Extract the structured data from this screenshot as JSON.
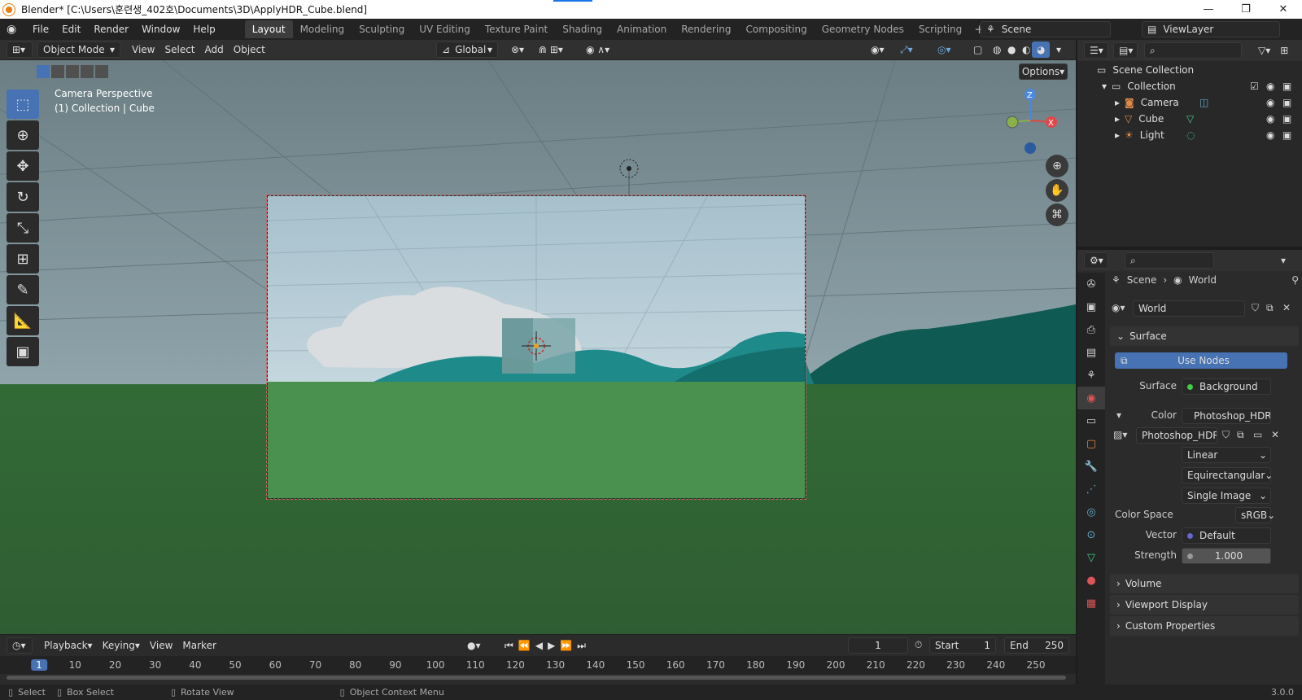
{
  "titlebar": {
    "title": "Blender* [C:\\Users\\훈련생_402호\\Documents\\3D\\ApplyHDR_Cube.blend]",
    "min": "—",
    "max": "❐",
    "close": "✕"
  },
  "menu": [
    "File",
    "Edit",
    "Render",
    "Window",
    "Help"
  ],
  "workspaces": [
    "Layout",
    "Modeling",
    "Sculpting",
    "UV Editing",
    "Texture Paint",
    "Shading",
    "Animation",
    "Rendering",
    "Compositing",
    "Geometry Nodes",
    "Scripting"
  ],
  "scene": "Scene",
  "viewlayer": "ViewLayer",
  "viewport_header": {
    "mode": "Object Mode",
    "menus": [
      "View",
      "Select",
      "Add",
      "Object"
    ],
    "orientation": "Global"
  },
  "viewport": {
    "line1": "Camera Perspective",
    "line2": "(1) Collection | Cube",
    "options": "Options"
  },
  "gizmo": {
    "z": "Z",
    "x": "X"
  },
  "timeline": {
    "menus": [
      "Playback",
      "Keying",
      "View",
      "Marker"
    ],
    "current_frame": "1",
    "start_label": "Start",
    "start": "1",
    "end_label": "End",
    "end": "250",
    "ticks": [
      "1",
      "10",
      "20",
      "30",
      "40",
      "50",
      "60",
      "70",
      "80",
      "90",
      "100",
      "110",
      "120",
      "130",
      "140",
      "150",
      "160",
      "170",
      "180",
      "190",
      "200",
      "210",
      "220",
      "230",
      "240",
      "250"
    ]
  },
  "statusbar": {
    "select": "Select",
    "box_select": "Box Select",
    "rotate": "Rotate View",
    "context": "Object Context Menu",
    "version": "3.0.0"
  },
  "outliner": {
    "scene_collection": "Scene Collection",
    "collection": "Collection",
    "items": [
      "Camera",
      "Cube",
      "Light"
    ]
  },
  "properties": {
    "breadcrumb_scene": "Scene",
    "breadcrumb_world": "World",
    "world_name": "World",
    "surface_panel": "Surface",
    "use_nodes": "Use Nodes",
    "surface_label": "Surface",
    "surface_value": "Background",
    "color_label": "Color",
    "color_value": "Photoshop_HDR....",
    "image_name": "Photoshop_HDR....",
    "interp": "Linear",
    "projection": "Equirectangular",
    "source": "Single Image",
    "colorspace_label": "Color Space",
    "colorspace": "sRGB",
    "vector_label": "Vector",
    "vector": "Default",
    "strength_label": "Strength",
    "strength": "1.000",
    "panels": [
      "Volume",
      "Viewport Display",
      "Custom Properties"
    ]
  },
  "colors": {
    "accent": "#4772b3",
    "active_ws": "#3d3d3d"
  }
}
